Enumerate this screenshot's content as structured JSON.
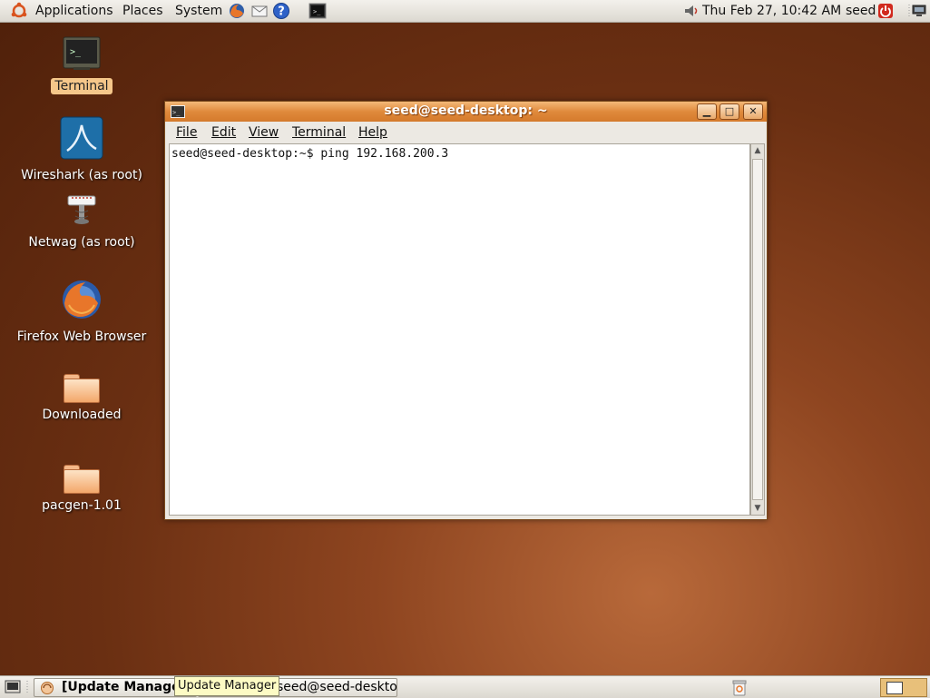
{
  "top_panel": {
    "menus": [
      "Applications",
      "Places",
      "System"
    ],
    "clock": "Thu Feb 27, 10:42 AM",
    "user": "seed"
  },
  "desktop_icons": [
    {
      "label": "Terminal",
      "icon": "terminal-icon",
      "selected": true
    },
    {
      "label": "Wireshark (as root)",
      "icon": "wireshark-icon"
    },
    {
      "label": "Netwag (as root)",
      "icon": "netwag-icon"
    },
    {
      "label": "Firefox Web Browser",
      "icon": "firefox-icon"
    },
    {
      "label": "Downloaded",
      "icon": "folder-icon"
    },
    {
      "label": "pacgen-1.01",
      "icon": "folder-icon"
    }
  ],
  "window": {
    "title": "seed@seed-desktop: ~",
    "menu": [
      "File",
      "Edit",
      "View",
      "Terminal",
      "Help"
    ],
    "terminal_text": "seed@seed-desktop:~$ ping 192.168.200.3"
  },
  "taskbar": {
    "tasks": [
      "[Update Manager]",
      "seed@seed-desktop: ~"
    ],
    "tooltip": "Update Manager"
  }
}
